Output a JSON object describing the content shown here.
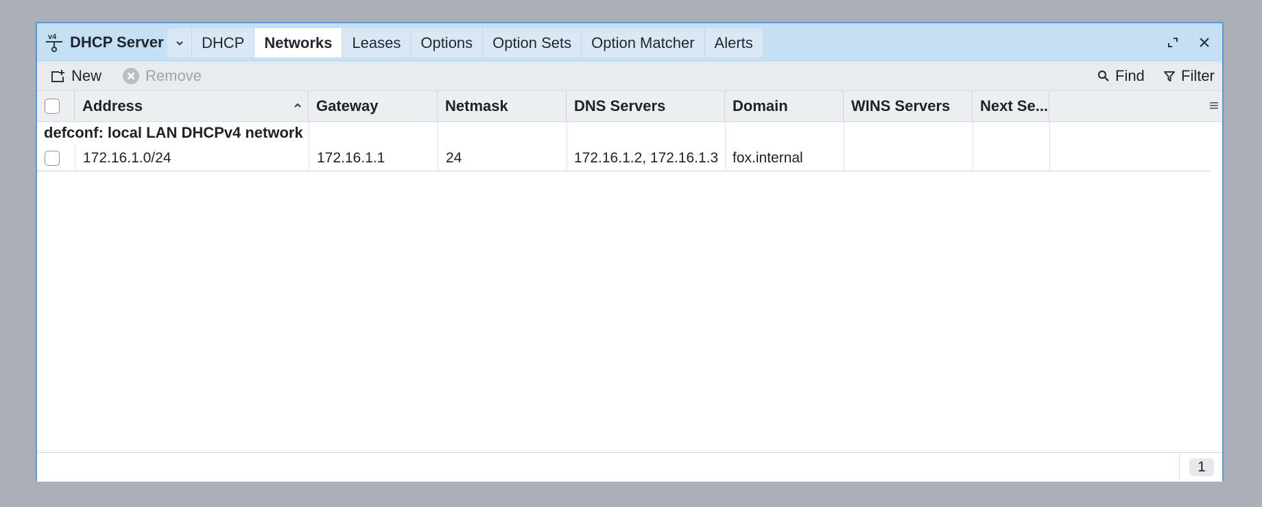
{
  "app": {
    "title": "DHCP Server"
  },
  "tabs": [
    {
      "label": "DHCP",
      "active": false
    },
    {
      "label": "Networks",
      "active": true
    },
    {
      "label": "Leases",
      "active": false
    },
    {
      "label": "Options",
      "active": false
    },
    {
      "label": "Option Sets",
      "active": false
    },
    {
      "label": "Option Matcher",
      "active": false
    },
    {
      "label": "Alerts",
      "active": false
    }
  ],
  "toolbar": {
    "new_label": "New",
    "remove_label": "Remove",
    "find_label": "Find",
    "filter_label": "Filter"
  },
  "columns": [
    "Address",
    "Gateway",
    "Netmask",
    "DNS Servers",
    "Domain",
    "WINS Servers",
    "Next Se..."
  ],
  "sort": {
    "column": "Address",
    "direction": "ascending"
  },
  "group": {
    "label": "defconf: local LAN DHCPv4 network"
  },
  "rows": [
    {
      "address": "172.16.1.0/24",
      "gateway": "172.16.1.1",
      "netmask": "24",
      "dns_servers": "172.16.1.2, 172.16.1.3",
      "domain": "fox.internal",
      "wins_servers": "",
      "next_server": ""
    }
  ],
  "footer": {
    "count": "1"
  },
  "colors": {
    "accent": "#5a98d4",
    "titlebar": "#c5dff3",
    "toolbar": "#e9ebee"
  },
  "icons": {
    "app": "network-tree-icon",
    "maximize": "maximize-icon",
    "close": "close-icon",
    "new": "new-icon",
    "remove": "remove-icon",
    "find": "search-icon",
    "filter": "filter-icon",
    "column_menu": "hamburger-icon"
  }
}
